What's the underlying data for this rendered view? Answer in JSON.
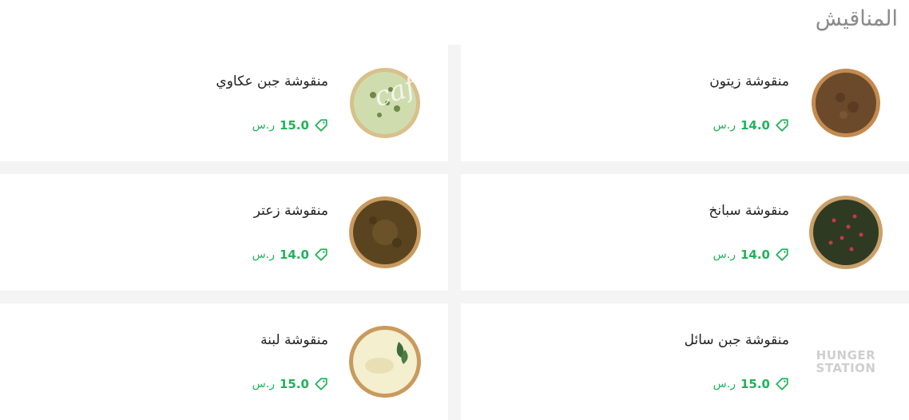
{
  "header": {
    "title": "المناقيش"
  },
  "watermark": "cafe",
  "items": [
    {
      "name": "منقوشة زيتون",
      "price": "14.0",
      "currency": "ر.س",
      "image": "zaatar-oil-pizza"
    },
    {
      "name": "منقوشة جبن عكاوي",
      "price": "15.0",
      "currency": "ر.س",
      "image": "akkawi-cheese-pizza"
    },
    {
      "name": "منقوشة سبانخ",
      "price": "14.0",
      "currency": "ر.س",
      "image": "spinach-pizza"
    },
    {
      "name": "منقوشة زعتر",
      "price": "14.0",
      "currency": "ر.س",
      "image": "zaatar-pizza"
    },
    {
      "name": "منقوشة جبن سائل",
      "price": "15.0",
      "currency": "ر.س",
      "image": "hungerstation-logo-placeholder",
      "logo_text": [
        "HUNGER",
        "STATION"
      ]
    },
    {
      "name": "منقوشة لبنة",
      "price": "15.0",
      "currency": "ر.س",
      "image": "labneh-pizza"
    }
  ],
  "colors": {
    "price": "#1fb35a",
    "header_text": "#8a8a8a",
    "background": "#f4f4f4"
  }
}
